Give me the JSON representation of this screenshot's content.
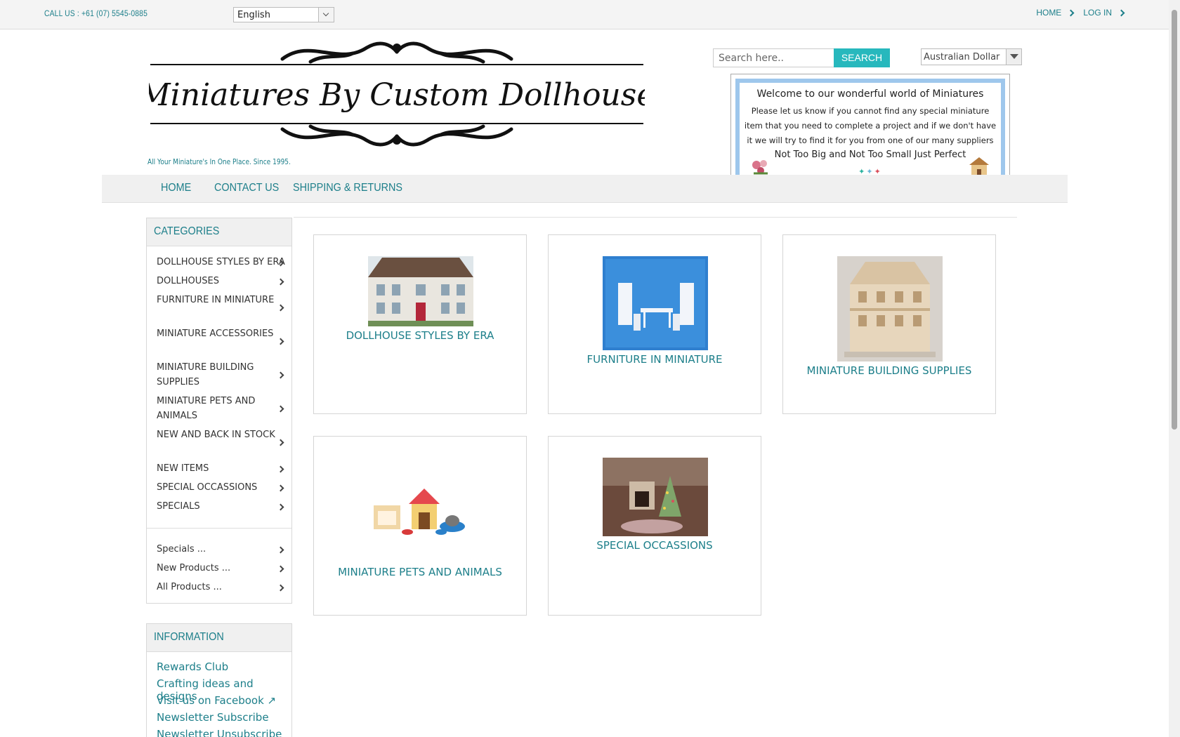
{
  "topbar": {
    "call": "CALL US : +61 (07) 5545-0885",
    "language": "English",
    "links": [
      "HOME",
      "LOG IN"
    ]
  },
  "header": {
    "logo_text": "Miniatures By Custom Dollhouse",
    "tagline": "All Your Miniature's In One Place. Since 1995.",
    "search_placeholder": "Search here..",
    "search_button": "SEARCH",
    "currency": "Australian Dollar"
  },
  "welcome": {
    "title": "Welcome to our wonderful world of Miniatures",
    "body": "Please let us know if you cannot find any special miniature item that you need  to complete a project and  if we don't have it we will try to find it for you from one of our many suppliers",
    "motto": "Not Too Big and Not Too Small Just Perfect"
  },
  "nav": [
    "HOME",
    "CONTACT US",
    "SHIPPING & RETURNS"
  ],
  "categories": {
    "title": "CATEGORIES",
    "items": [
      "DOLLHOUSE STYLES BY ERA",
      "DOLLHOUSES",
      "FURNITURE IN MINIATURE",
      "MINIATURE ACCESSORIES",
      "MINIATURE BUILDING SUPPLIES",
      "MINIATURE PETS AND ANIMALS",
      "NEW AND BACK IN STOCK",
      "NEW ITEMS",
      "SPECIAL OCCASSIONS",
      "SPECIALS"
    ],
    "extra": [
      "Specials ...",
      "New Products ...",
      "All Products ..."
    ]
  },
  "information": {
    "title": "INFORMATION",
    "items": [
      "Rewards Club",
      "Crafting ideas and designs",
      "Visit us on Facebook ↗",
      "Newsletter Subscribe",
      "Newsletter Unsubscribe"
    ]
  },
  "cards": [
    "DOLLHOUSE STYLES BY ERA",
    "FURNITURE IN MINIATURE",
    "MINIATURE BUILDING SUPPLIES",
    "MINIATURE PETS AND ANIMALS",
    "SPECIAL OCCASSIONS"
  ]
}
